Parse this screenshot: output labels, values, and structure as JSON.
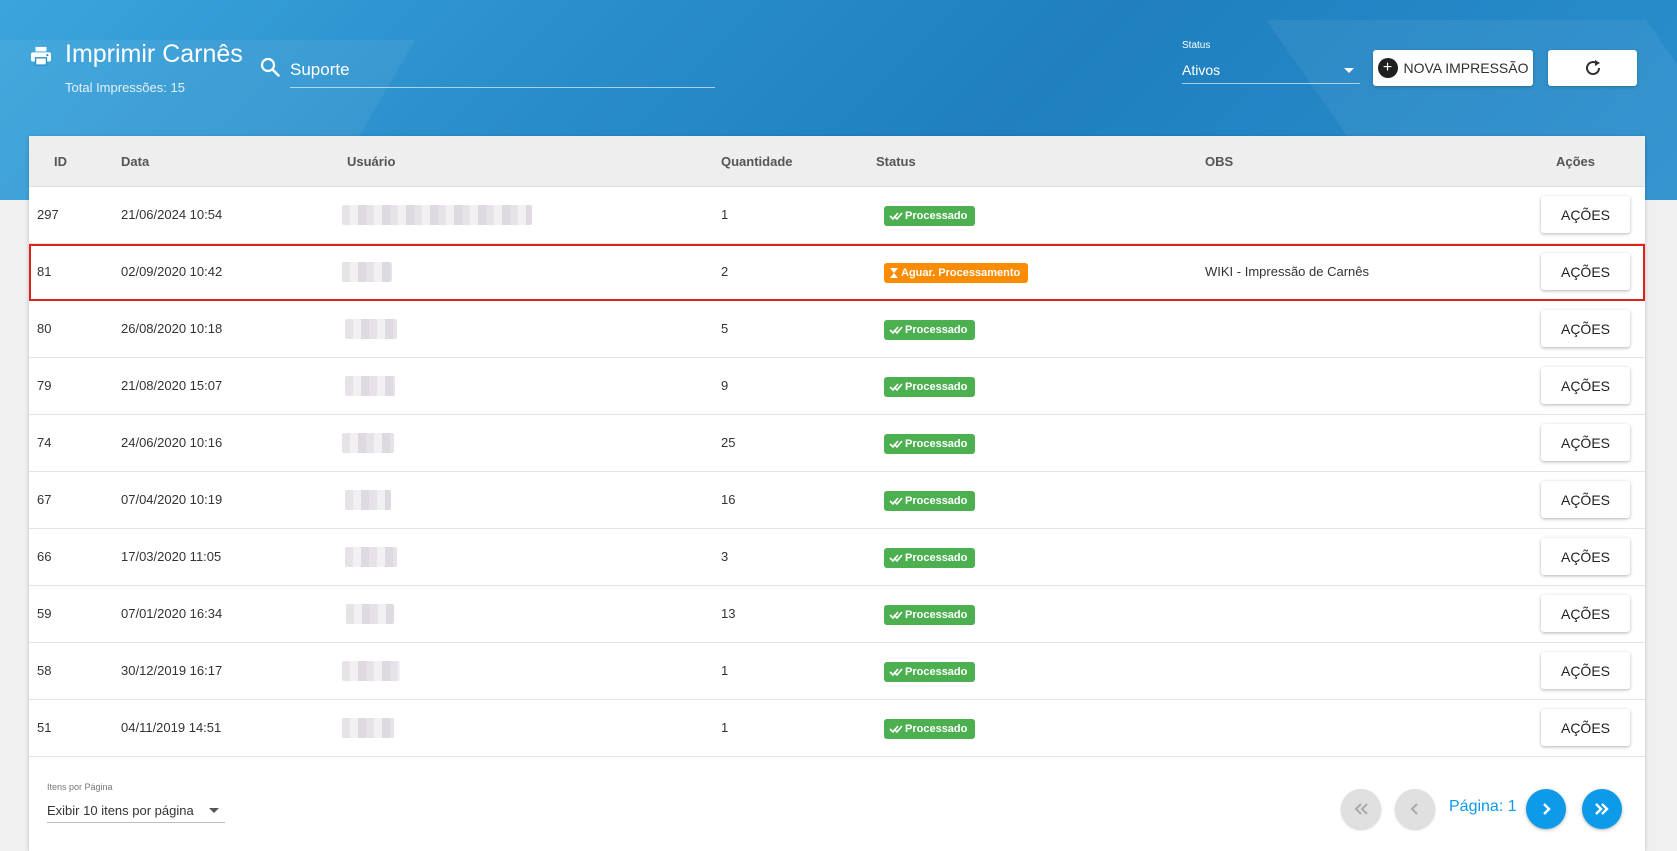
{
  "header": {
    "title": "Imprimir Carnês",
    "subtitle": "Total Impressões: 15",
    "search_value": "Suporte",
    "status_label": "Status",
    "status_value": "Ativos",
    "new_button_label": "NOVA IMPRESSÃO",
    "icons": [
      "printer-icon",
      "search-icon",
      "plus-circle-icon",
      "refresh-icon"
    ]
  },
  "table": {
    "columns": {
      "id": "ID",
      "data": "Data",
      "usuario": "Usuário",
      "quantidade": "Quantidade",
      "status": "Status",
      "obs": "OBS",
      "acoes": "Ações"
    },
    "rows": [
      {
        "id": "297",
        "data": "21/06/2024 10:54",
        "quantidade": "1",
        "status": "Processado",
        "obs": "",
        "action": "AÇÕES"
      },
      {
        "id": "81",
        "data": "02/09/2020 10:42",
        "quantidade": "2",
        "status": "Aguar. Processamento",
        "obs": "WIKI - Impressão de Carnês",
        "action": "AÇÕES"
      },
      {
        "id": "80",
        "data": "26/08/2020 10:18",
        "quantidade": "5",
        "status": "Processado",
        "obs": "",
        "action": "AÇÕES"
      },
      {
        "id": "79",
        "data": "21/08/2020 15:07",
        "quantidade": "9",
        "status": "Processado",
        "obs": "",
        "action": "AÇÕES"
      },
      {
        "id": "74",
        "data": "24/06/2020 10:16",
        "quantidade": "25",
        "status": "Processado",
        "obs": "",
        "action": "AÇÕES"
      },
      {
        "id": "67",
        "data": "07/04/2020 10:19",
        "quantidade": "16",
        "status": "Processado",
        "obs": "",
        "action": "AÇÕES"
      },
      {
        "id": "66",
        "data": "17/03/2020 11:05",
        "quantidade": "3",
        "status": "Processado",
        "obs": "",
        "action": "AÇÕES"
      },
      {
        "id": "59",
        "data": "07/01/2020 16:34",
        "quantidade": "13",
        "status": "Processado",
        "obs": "",
        "action": "AÇÕES"
      },
      {
        "id": "58",
        "data": "30/12/2019 16:17",
        "quantidade": "1",
        "status": "Processado",
        "obs": "",
        "action": "AÇÕES"
      },
      {
        "id": "51",
        "data": "04/11/2019 14:51",
        "quantidade": "1",
        "status": "Processado",
        "obs": "",
        "action": "AÇÕES"
      }
    ]
  },
  "footer": {
    "per_page_label": "Itens por Página",
    "per_page_value": "Exibir 10 itens por página",
    "page_label": "Página: 1"
  },
  "colors": {
    "banner": "#2b8fcc",
    "processed": "#4caf50",
    "waiting": "#fb8c00",
    "highlight": "#e0201a",
    "pager_active": "#0d9ae8"
  }
}
